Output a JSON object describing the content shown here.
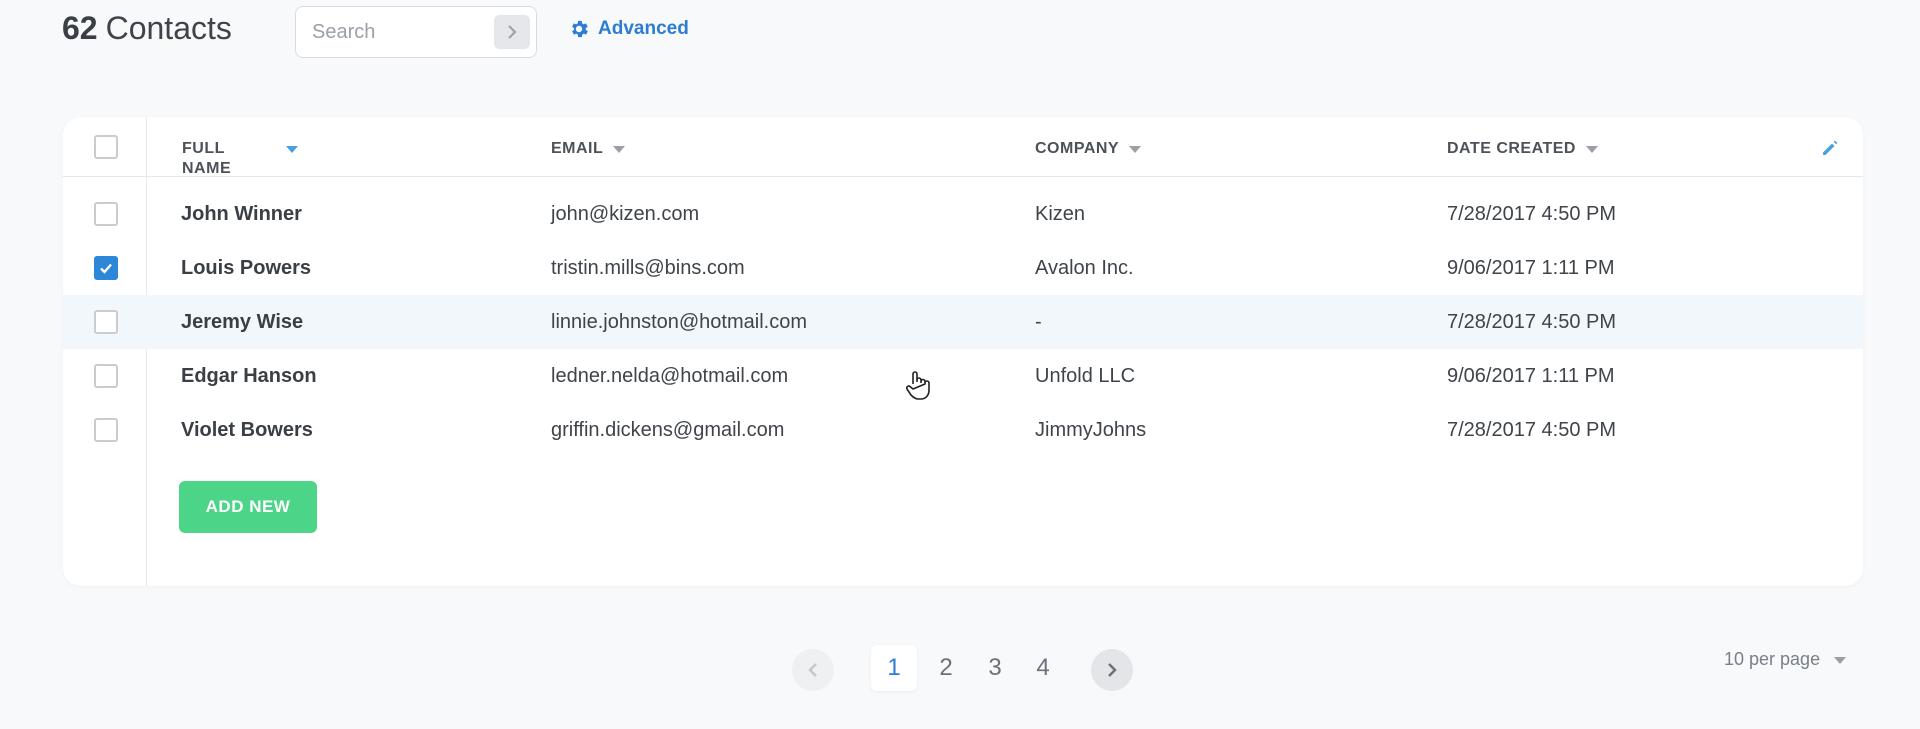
{
  "header": {
    "count": "62",
    "title": "Contacts",
    "search_placeholder": "Search",
    "advanced_label": "Advanced"
  },
  "table": {
    "columns": [
      {
        "key": "full_name",
        "label": "FULL NAME",
        "sort_active": true
      },
      {
        "key": "email",
        "label": "EMAIL",
        "sort_active": false
      },
      {
        "key": "company",
        "label": "COMPANY",
        "sort_active": false
      },
      {
        "key": "date_created",
        "label": "DATE CREATED",
        "sort_active": false
      }
    ],
    "rows": [
      {
        "name": "John Winner",
        "email": "john@kizen.com",
        "company": "Kizen",
        "date": "7/28/2017 4:50 PM",
        "checked": false,
        "highlight": false
      },
      {
        "name": "Louis Powers",
        "email": "tristin.mills@bins.com",
        "company": "Avalon Inc.",
        "date": "9/06/2017 1:11 PM",
        "checked": true,
        "highlight": false
      },
      {
        "name": "Jeremy Wise",
        "email": "linnie.johnston@hotmail.com",
        "company": "-",
        "date": "7/28/2017 4:50 PM",
        "checked": false,
        "highlight": true
      },
      {
        "name": "Edgar Hanson",
        "email": "ledner.nelda@hotmail.com",
        "company": "Unfold LLC",
        "date": "9/06/2017 1:11 PM",
        "checked": false,
        "highlight": false
      },
      {
        "name": "Violet Bowers",
        "email": "griffin.dickens@gmail.com",
        "company": "JimmyJohns",
        "date": "7/28/2017 4:50 PM",
        "checked": false,
        "highlight": false
      }
    ],
    "add_label": "ADD NEW"
  },
  "pagination": {
    "pages": [
      "1",
      "2",
      "3",
      "4"
    ],
    "current": "1",
    "per_page": "10 per page"
  },
  "colors": {
    "accent": "#2d7dd2",
    "add_button": "#4cd489",
    "checkbox_checked": "#2d87d8"
  },
  "icons": {
    "advanced": "gear-icon",
    "search_submit": "chevron-right-icon",
    "edit_columns": "pencil-icon",
    "cursor": "hand-cursor-icon"
  }
}
